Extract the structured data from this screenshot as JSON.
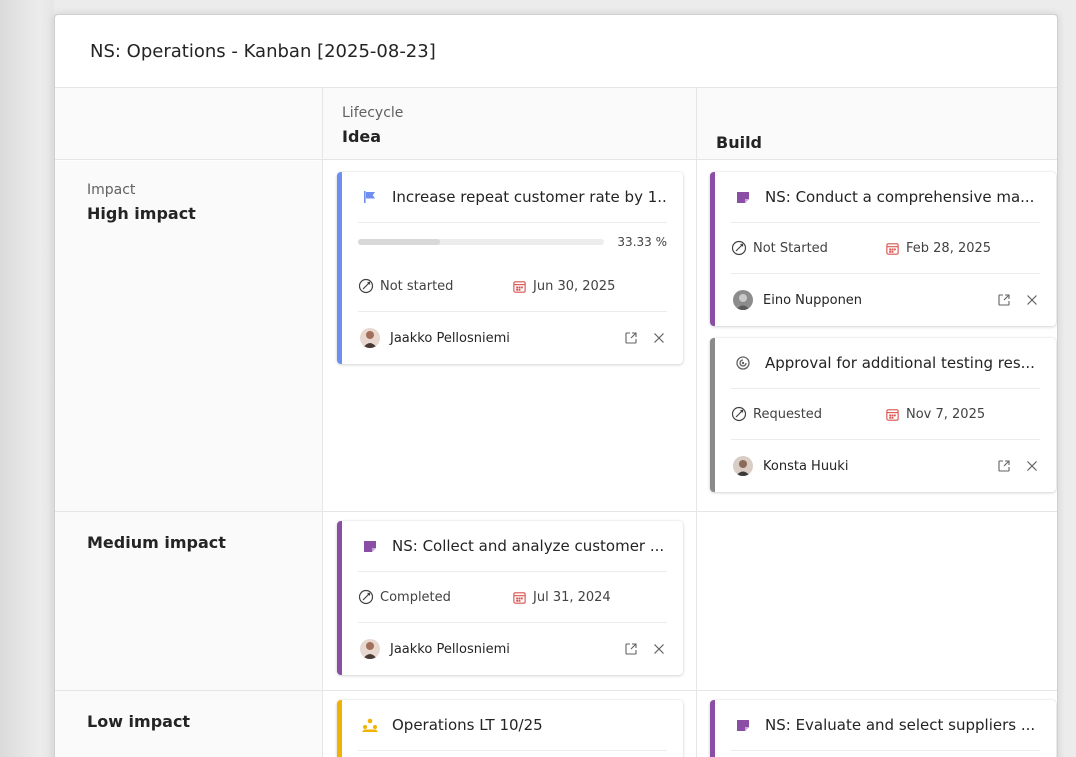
{
  "board": {
    "title": "NS: Operations - Kanban [2025-08-23]"
  },
  "columns": {
    "group_label": "Lifecycle",
    "items": [
      {
        "label": "Idea"
      },
      {
        "label": "Build"
      }
    ]
  },
  "rows": {
    "group_label": "Impact",
    "items": [
      {
        "label": "High impact"
      },
      {
        "label": "Medium impact"
      },
      {
        "label": "Low impact"
      }
    ]
  },
  "cards": {
    "high_idea_1": {
      "icon": "flag-icon",
      "accent": "#6f8ff0",
      "title": "Increase repeat customer rate by 1...",
      "progress": 33.33,
      "progress_label": "33.33 %",
      "status": "Not started",
      "date": "Jun 30, 2025",
      "person": "Jaakko Pellosniemi"
    },
    "high_build_1": {
      "icon": "task-icon",
      "accent": "#8a4fa5",
      "title": "NS: Conduct a comprehensive ma...",
      "status": "Not Started",
      "date": "Feb 28, 2025",
      "person": "Eino Nupponen"
    },
    "high_build_2": {
      "icon": "approval-icon",
      "accent": "#8a8a8a",
      "title": "Approval for additional testing res...",
      "status": "Requested",
      "date": "Nov 7, 2025",
      "person": "Konsta Huuki"
    },
    "medium_idea_1": {
      "icon": "task-icon",
      "accent": "#8a4fa5",
      "title": "NS: Collect and analyze customer ...",
      "status": "Completed",
      "date": "Jul 31, 2024",
      "person": "Jaakko Pellosniemi"
    },
    "low_idea_1": {
      "icon": "team-icon",
      "accent": "#f2b300",
      "title": "Operations LT 10/25"
    },
    "low_build_1": {
      "icon": "task-icon",
      "accent": "#8a4fa5",
      "title": "NS: Evaluate and select suppliers ..."
    }
  },
  "colors": {
    "date_icon": "#d9534f",
    "task_icon": "#8a4fa5",
    "flag_icon": "#6f8ff0",
    "team_icon": "#f2b300"
  }
}
